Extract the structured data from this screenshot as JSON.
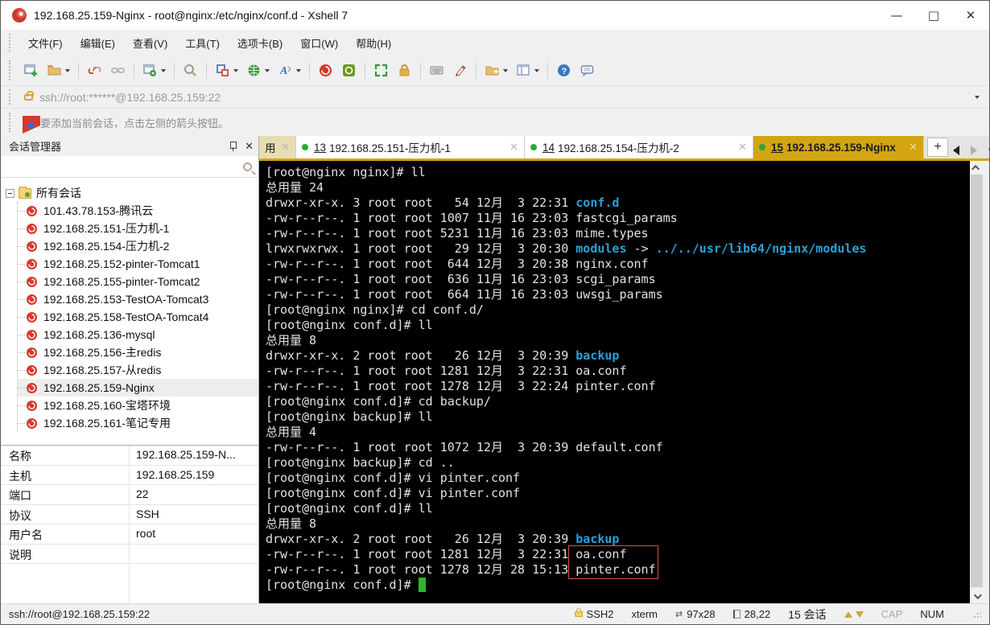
{
  "window": {
    "title": "192.168.25.159-Nginx - root@nginx:/etc/nginx/conf.d - Xshell 7"
  },
  "menu": {
    "items": [
      "文件(F)",
      "编辑(E)",
      "查看(V)",
      "工具(T)",
      "选项卡(B)",
      "窗口(W)",
      "帮助(H)"
    ]
  },
  "toolbar": {
    "icon_names": [
      "new-session-icon",
      "open-session-icon",
      "disconnect-icon",
      "reconnect-icon",
      "session-properties-icon",
      "find-icon",
      "compose-layout-icon",
      "globe-encoding-icon",
      "font-icon",
      "xshell-icon",
      "xftp-icon",
      "fullscreen-icon",
      "lock-icon",
      "virtual-keyboard-icon",
      "highlight-pen-icon",
      "new-folder-icon",
      "window-layout-icon",
      "help-icon",
      "feedback-icon"
    ]
  },
  "address_bar": {
    "url": "ssh://root:******@192.168.25.159:22"
  },
  "info_bar": {
    "text": "要添加当前会话，点击左侧的箭头按钮。"
  },
  "sidebar": {
    "title": "会话管理器",
    "root_label": "所有会话",
    "sessions": [
      {
        "label": "101.43.78.153-腾讯云",
        "selected": false
      },
      {
        "label": "192.168.25.151-压力机-1",
        "selected": false
      },
      {
        "label": "192.168.25.154-压力机-2",
        "selected": false
      },
      {
        "label": "192.168.25.152-pinter-Tomcat1",
        "selected": false
      },
      {
        "label": "192.168.25.155-pinter-Tomcat2",
        "selected": false
      },
      {
        "label": "192.168.25.153-TestOA-Tomcat3",
        "selected": false
      },
      {
        "label": "192.168.25.158-TestOA-Tomcat4",
        "selected": false
      },
      {
        "label": "192.168.25.136-mysql",
        "selected": false
      },
      {
        "label": "192.168.25.156-主redis",
        "selected": false
      },
      {
        "label": "192.168.25.157-从redis",
        "selected": false
      },
      {
        "label": "192.168.25.159-Nginx",
        "selected": true
      },
      {
        "label": "192.168.25.160-宝塔环境",
        "selected": false
      },
      {
        "label": "192.168.25.161-笔记专用",
        "selected": false
      }
    ]
  },
  "properties": {
    "rows": [
      {
        "label": "名称",
        "value": "192.168.25.159-N..."
      },
      {
        "label": "主机",
        "value": "192.168.25.159"
      },
      {
        "label": "端口",
        "value": "22"
      },
      {
        "label": "协议",
        "value": "SSH"
      },
      {
        "label": "用户名",
        "value": "root"
      },
      {
        "label": "说明",
        "value": ""
      }
    ]
  },
  "tabs": {
    "items": [
      {
        "num": "",
        "label": "用",
        "state": "partial"
      },
      {
        "num": "13",
        "label": "192.168.25.151-压力机-1",
        "state": "normal"
      },
      {
        "num": "14",
        "label": "192.168.25.154-压力机-2",
        "state": "normal"
      },
      {
        "num": "15",
        "label": "192.168.25.159-Nginx",
        "state": "active"
      }
    ],
    "add_label": "+"
  },
  "terminal": {
    "lines": [
      [
        {
          "t": "[root@nginx nginx]# ll"
        }
      ],
      [
        {
          "t": "总用量 24"
        }
      ],
      [
        {
          "t": "drwxr-xr-x. 3 root root   54 12月  3 22:31 "
        },
        {
          "t": "conf.d",
          "c": "d"
        }
      ],
      [
        {
          "t": "-rw-r--r--. 1 root root 1007 11月 16 23:03 fastcgi_params"
        }
      ],
      [
        {
          "t": "-rw-r--r--. 1 root root 5231 11月 16 23:03 mime.types"
        }
      ],
      [
        {
          "t": "lrwxrwxrwx. 1 root root   29 12月  3 20:30 "
        },
        {
          "t": "modules",
          "c": "d"
        },
        {
          "t": " -> "
        },
        {
          "t": "../../usr/lib64/nginx/modules",
          "c": "d"
        }
      ],
      [
        {
          "t": "-rw-r--r--. 1 root root  644 12月  3 20:38 nginx.conf"
        }
      ],
      [
        {
          "t": "-rw-r--r--. 1 root root  636 11月 16 23:03 scgi_params"
        }
      ],
      [
        {
          "t": "-rw-r--r--. 1 root root  664 11月 16 23:03 uwsgi_params"
        }
      ],
      [
        {
          "t": "[root@nginx nginx]# cd conf.d/"
        }
      ],
      [
        {
          "t": "[root@nginx conf.d]# ll"
        }
      ],
      [
        {
          "t": "总用量 8"
        }
      ],
      [
        {
          "t": "drwxr-xr-x. 2 root root   26 12月  3 20:39 "
        },
        {
          "t": "backup",
          "c": "d"
        }
      ],
      [
        {
          "t": "-rw-r--r--. 1 root root 1281 12月  3 22:31 oa.conf"
        }
      ],
      [
        {
          "t": "-rw-r--r--. 1 root root 1278 12月  3 22:24 pinter.conf"
        }
      ],
      [
        {
          "t": "[root@nginx conf.d]# cd backup/"
        }
      ],
      [
        {
          "t": "[root@nginx backup]# ll"
        }
      ],
      [
        {
          "t": "总用量 4"
        }
      ],
      [
        {
          "t": "-rw-r--r--. 1 root root 1072 12月  3 20:39 default.conf"
        }
      ],
      [
        {
          "t": "[root@nginx backup]# cd .."
        }
      ],
      [
        {
          "t": "[root@nginx conf.d]# vi pinter.conf"
        }
      ],
      [
        {
          "t": "[root@nginx conf.d]# vi pinter.conf"
        }
      ],
      [
        {
          "t": "[root@nginx conf.d]# ll"
        }
      ],
      [
        {
          "t": "总用量 8"
        }
      ],
      [
        {
          "t": "drwxr-xr-x. 2 root root   26 12月  3 20:39 "
        },
        {
          "t": "backup",
          "c": "d"
        }
      ],
      [
        {
          "t": "-rw-r--r--. 1 root root 1281 12月  3 22:31 oa.conf"
        }
      ],
      [
        {
          "t": "-rw-r--r--. 1 root root 1278 12月 28 15:13 pinter.conf"
        }
      ],
      [
        {
          "t": "[root@nginx conf.d]# "
        },
        {
          "t": " ",
          "c": "k"
        }
      ]
    ]
  },
  "status_bar": {
    "left": "ssh://root@192.168.25.159:22",
    "protocol": "SSH2",
    "term_type": "xterm",
    "size": "97x28",
    "cursor": "28,22",
    "session_count": "15 会话",
    "cap": "CAP",
    "num": "NUM"
  },
  "colors": {
    "accent_gold": "#d3a513",
    "terminal_dir_blue": "#2aa1da",
    "cursor_green": "#2fb52f",
    "annotation_red": "#d9544a",
    "session_icon_red": "#d63a2f"
  }
}
